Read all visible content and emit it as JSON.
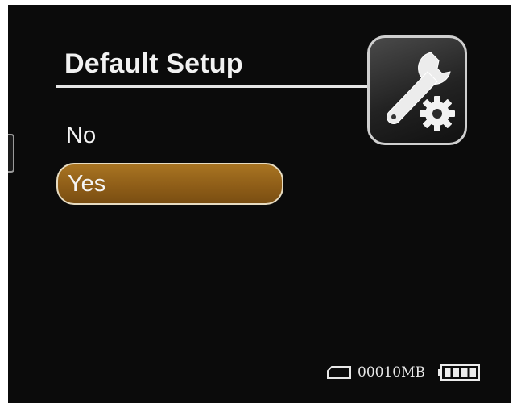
{
  "menu": {
    "title": "Default Setup",
    "items": [
      {
        "label": "No",
        "selected": false
      },
      {
        "label": "Yes",
        "selected": true
      }
    ]
  },
  "status": {
    "storage": "00010MB",
    "battery_level": 1.0
  },
  "icons": {
    "header": "wrench-gear-settings-icon",
    "storage": "sd-card-icon",
    "battery": "battery-icon"
  },
  "colors": {
    "background": "#0b0b0b",
    "selection": "#8f5e18",
    "selection_border": "#e7dcc2",
    "text": "#f4f4f4"
  }
}
